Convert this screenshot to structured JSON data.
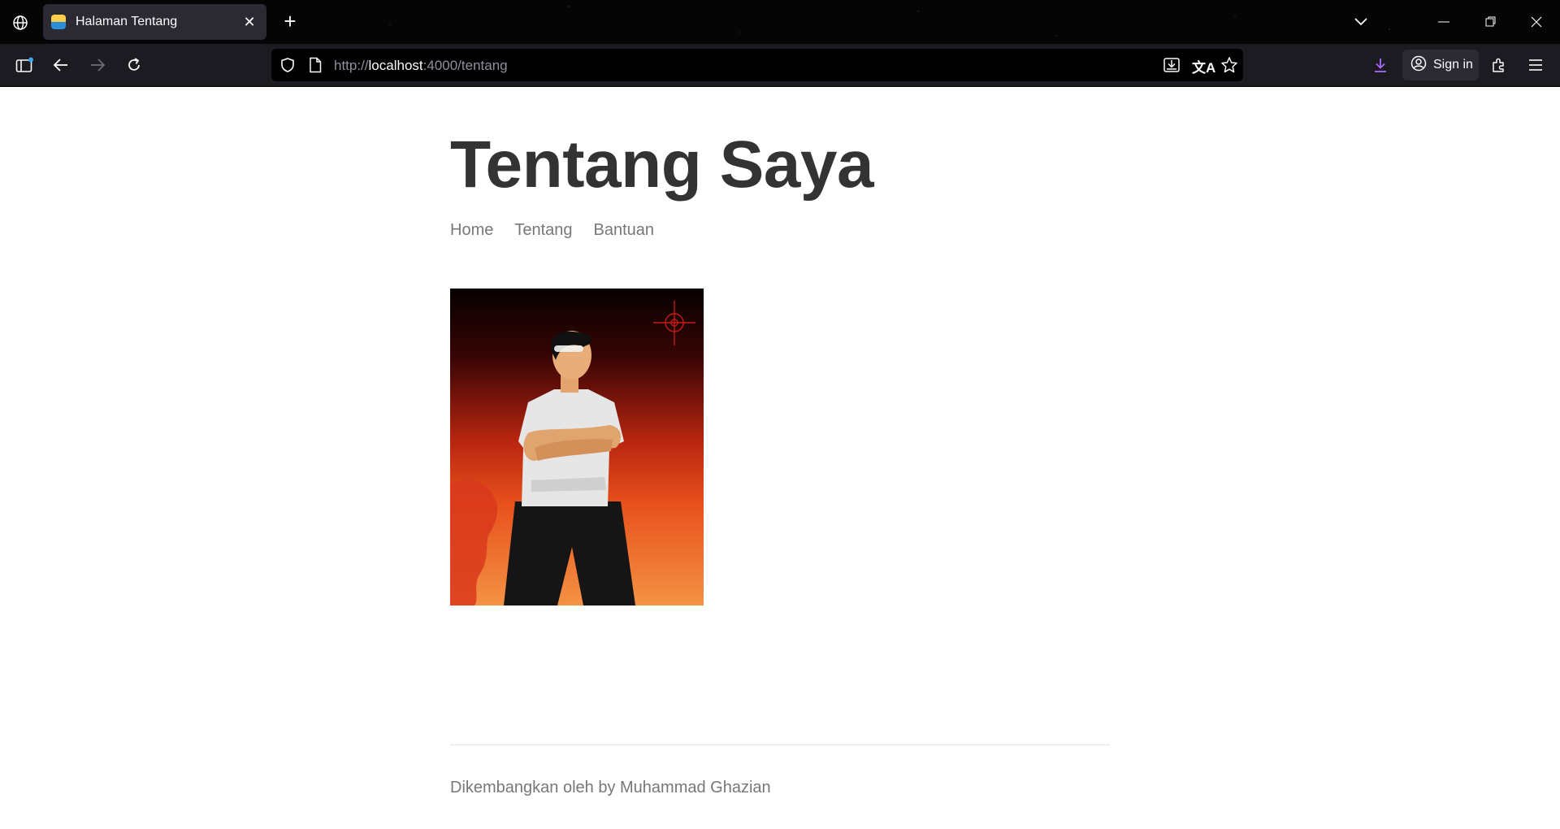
{
  "browser": {
    "tab": {
      "title": "Halaman Tentang"
    },
    "url": {
      "scheme": "http://",
      "host": "localhost",
      "rest": ":4000/tentang"
    },
    "signin_label": "Sign in",
    "icons": [
      "globe-icon",
      "close-icon",
      "plus-icon",
      "chevron-down-icon",
      "minimize-icon",
      "restore-icon",
      "window-close-icon",
      "sidebar-icon",
      "back-arrow-icon",
      "forward-arrow-icon",
      "reload-icon",
      "shield-icon",
      "page-icon",
      "save-to-device-icon",
      "translate-icon",
      "star-icon",
      "download-icon",
      "account-icon",
      "extensions-icon",
      "menu-icon"
    ],
    "download_color": "#a56bff"
  },
  "page": {
    "title": "Tentang Saya",
    "nav": [
      {
        "label": "Home"
      },
      {
        "label": "Tentang"
      },
      {
        "label": "Bantuan"
      }
    ],
    "footer": "Dikembangkan oleh by Muhammad Ghazian"
  },
  "colors": {
    "title": "#333333",
    "nav_text": "#777777",
    "photo_gradient_top": "#050000",
    "photo_gradient_bottom": "#f49244"
  }
}
